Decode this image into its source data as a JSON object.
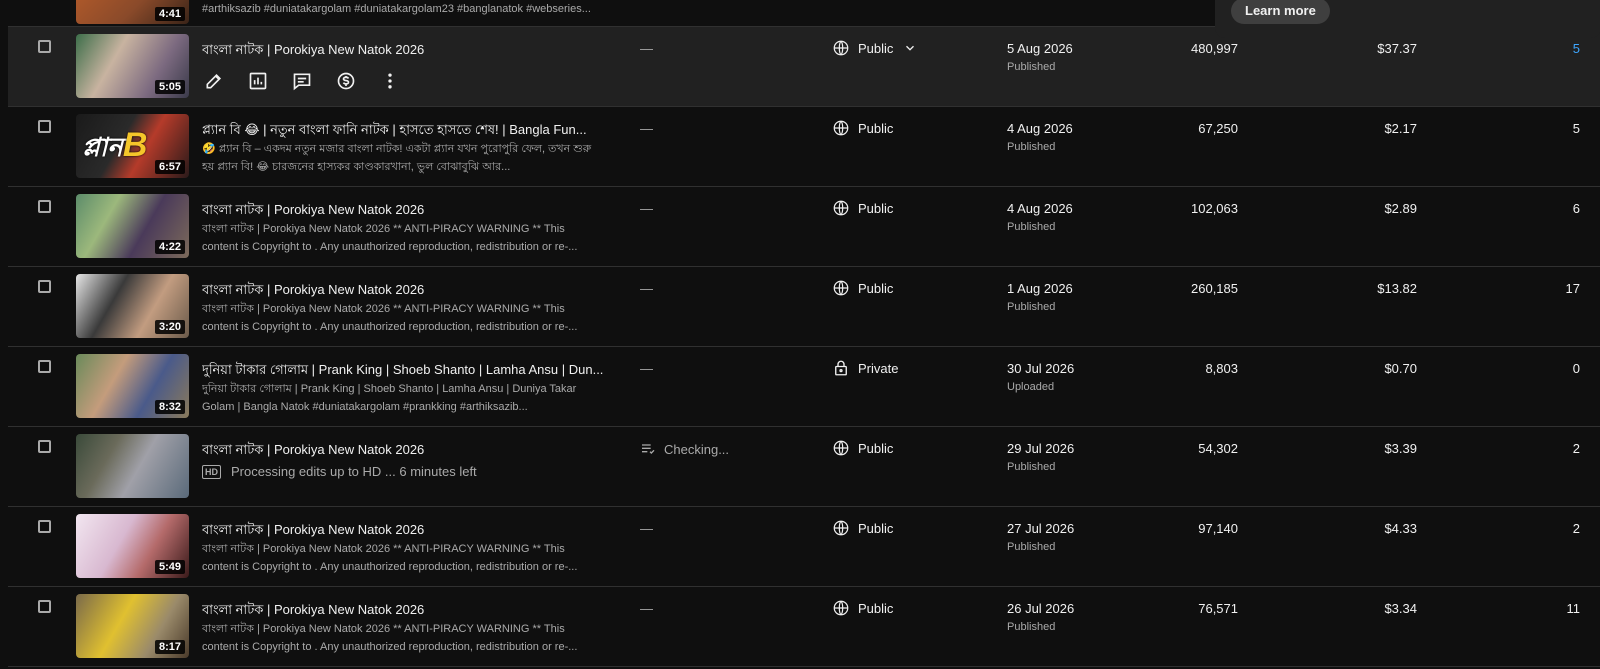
{
  "top_partial": {
    "duration": "4:41",
    "description": "#arthiksazib #duniatakargolam #duniatakargolam23 #banglanatok #webseries..."
  },
  "learn_more_label": "Learn more",
  "rows": [
    {
      "title": "বাংলা নাটক | Porokiya New Natok 2026",
      "duration": "5:05",
      "restrictions": "—",
      "visibility": "Public",
      "date": "5 Aug 2026",
      "status": "Published",
      "views": "480,997",
      "revenue": "$37.37",
      "comments": "5"
    },
    {
      "title": "প্ল্যান বি 😂 | নতুন বাংলা ফানি নাটক | হাসতে হাসতে শেষ! | Bangla Fun...",
      "description": "🤣 প্ল্যান বি – একদম নতুন মজার বাংলা নাটক! একটা প্ল্যান যখন পুরোপুরি ফেল, তখন শুরু হয় প্ল্যান বি! 😂 চারজনের হাস্যকর কাণ্ডকারখানা, ভুল বোঝাবুঝি আর...",
      "duration": "6:57",
      "thumb_text_a": "প্লান",
      "thumb_text_b": "B",
      "restrictions": "—",
      "visibility": "Public",
      "date": "4 Aug 2026",
      "status": "Published",
      "views": "67,250",
      "revenue": "$2.17",
      "comments": "5"
    },
    {
      "title": "বাংলা নাটক | Porokiya New Natok 2026",
      "description": "বাংলা নাটক | Porokiya New Natok 2026 ** ANTI-PIRACY WARNING ** This content is Copyright to . Any unauthorized reproduction, redistribution or re-...",
      "duration": "4:22",
      "restrictions": "—",
      "visibility": "Public",
      "date": "4 Aug 2026",
      "status": "Published",
      "views": "102,063",
      "revenue": "$2.89",
      "comments": "6"
    },
    {
      "title": "বাংলা নাটক | Porokiya New Natok 2026",
      "description": "বাংলা নাটক | Porokiya New Natok 2026 ** ANTI-PIRACY WARNING ** This content is Copyright to . Any unauthorized reproduction, redistribution or re-...",
      "duration": "3:20",
      "restrictions": "—",
      "visibility": "Public",
      "date": "1 Aug 2026",
      "status": "Published",
      "views": "260,185",
      "revenue": "$13.82",
      "comments": "17"
    },
    {
      "title": "দুনিয়া টাকার গোলাম | Prank King | Shoeb Shanto | Lamha Ansu | Dun...",
      "description": "দুনিয়া টাকার গোলাম | Prank King | Shoeb Shanto | Lamha Ansu | Duniya Takar Golam | Bangla Natok #duniatakargolam #prankking #arthiksazib...",
      "duration": "8:32",
      "restrictions": "—",
      "visibility": "Private",
      "date": "30 Jul 2026",
      "status": "Uploaded",
      "views": "8,803",
      "revenue": "$0.70",
      "comments": "0"
    },
    {
      "title": "বাংলা নাটক | Porokiya New Natok 2026",
      "processing_badge": "HD",
      "processing_text": "Processing edits up to HD ... 6 minutes left",
      "restrictions": "Checking...",
      "visibility": "Public",
      "date": "29 Jul 2026",
      "status": "Published",
      "views": "54,302",
      "revenue": "$3.39",
      "comments": "2"
    },
    {
      "title": "বাংলা নাটক | Porokiya New Natok 2026",
      "description": "বাংলা নাটক | Porokiya New Natok 2026 ** ANTI-PIRACY WARNING ** This content is Copyright to . Any unauthorized reproduction, redistribution or re-...",
      "duration": "5:49",
      "restrictions": "—",
      "visibility": "Public",
      "date": "27 Jul 2026",
      "status": "Published",
      "views": "97,140",
      "revenue": "$4.33",
      "comments": "2"
    },
    {
      "title": "বাংলা নাটক | Porokiya New Natok 2026",
      "description": "বাংলা নাটক | Porokiya New Natok 2026 ** ANTI-PIRACY WARNING ** This content is Copyright to . Any unauthorized reproduction, redistribution or re-...",
      "duration": "8:17",
      "restrictions": "—",
      "visibility": "Public",
      "date": "26 Jul 2026",
      "status": "Published",
      "views": "76,571",
      "revenue": "$3.34",
      "comments": "11"
    }
  ]
}
